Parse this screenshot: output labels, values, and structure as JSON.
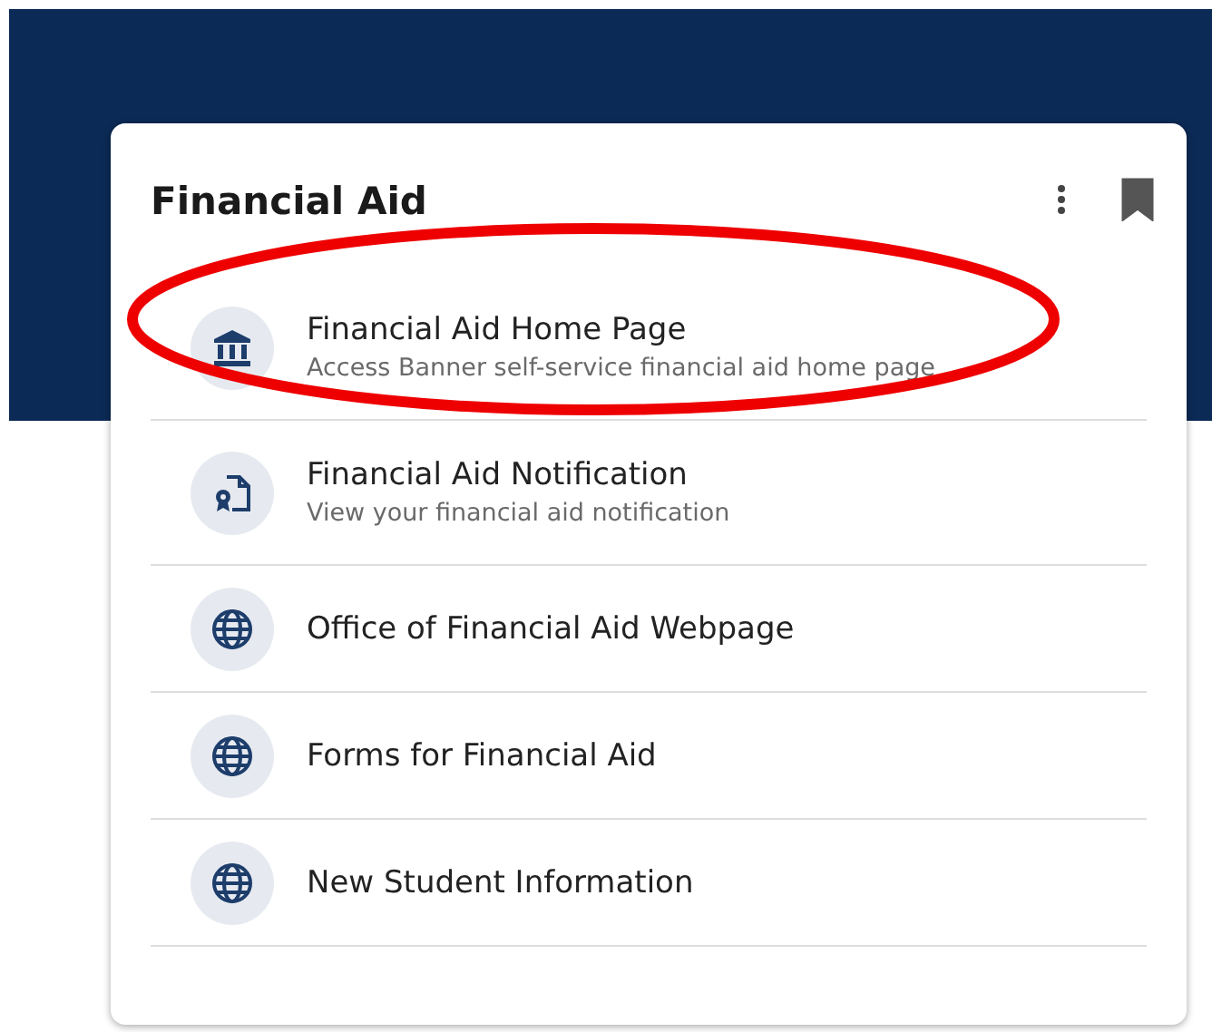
{
  "card": {
    "title": "Financial Aid",
    "bookmarked": true
  },
  "items": [
    {
      "kind": "bank",
      "title": "Financial Aid Home Page",
      "subtitle": "Access Banner self-service financial aid home page",
      "circled": true
    },
    {
      "kind": "document",
      "title": "Financial Aid Notification",
      "subtitle": "View your financial aid notification",
      "circled": false
    },
    {
      "kind": "web",
      "title": "Office of Financial Aid Webpage",
      "circled": false
    },
    {
      "kind": "web",
      "title": "Forms for Financial Aid",
      "circled": false
    },
    {
      "kind": "web",
      "title": "New Student Information",
      "circled": false
    }
  ]
}
